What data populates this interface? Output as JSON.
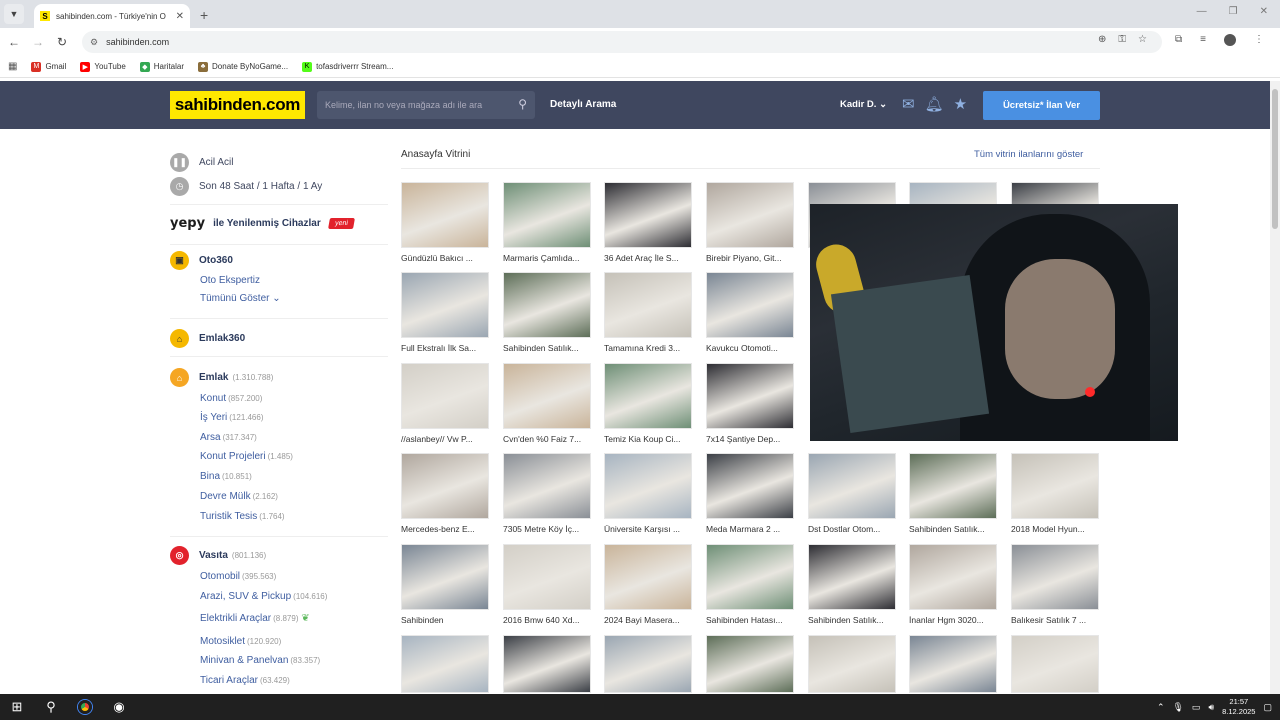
{
  "browser": {
    "tab_title": "sahibinden.com - Türkiye'nin O",
    "tab_favicon": "S",
    "url": "sahibinden.com",
    "bookmarks": [
      {
        "label": "Gmail",
        "icon": "gmail-icon",
        "color": "#d93025"
      },
      {
        "label": "YouTube",
        "icon": "youtube-icon",
        "color": "#ff0000"
      },
      {
        "label": "Haritalar",
        "icon": "maps-icon",
        "color": "#34a853"
      },
      {
        "label": "Donate ByNoGame...",
        "icon": "donate-icon",
        "color": "#8a6d3b"
      },
      {
        "label": "tofasdriverrr Stream...",
        "icon": "kick-icon",
        "color": "#53fc18"
      }
    ]
  },
  "header": {
    "logo": "sahibinden.com",
    "search_placeholder": "Kelime, ilan no veya mağaza adı ile ara",
    "detailed_search": "Detaylı Arama",
    "user": "Kadir D.",
    "post_button": "Ücretsiz* İlan Ver",
    "colors": {
      "bg": "#3f475f",
      "logo": "#ffe800",
      "button": "#4a90e2"
    }
  },
  "sidebar": {
    "acil": "Acil Acil",
    "son48": "Son 48 Saat / 1 Hafta / 1 Ay",
    "yepy": "yepy",
    "yepy_text": "ile Yenilenmiş Cihazlar",
    "yeni": "yeni",
    "oto360": "Oto360",
    "oto_ekspertiz": "Oto Ekspertiz",
    "tumunu": "Tümünü Göster",
    "emlak360": "Emlak360",
    "emlak": {
      "label": "Emlak",
      "count": "(1.310.788)"
    },
    "emlak_items": [
      {
        "label": "Konut",
        "count": "(857.200)"
      },
      {
        "label": "İş Yeri",
        "count": "(121.466)"
      },
      {
        "label": "Arsa",
        "count": "(317.347)"
      },
      {
        "label": "Konut Projeleri",
        "count": "(1.485)"
      },
      {
        "label": "Bina",
        "count": "(10.851)"
      },
      {
        "label": "Devre Mülk",
        "count": "(2.162)"
      },
      {
        "label": "Turistik Tesis",
        "count": "(1.764)"
      }
    ],
    "vasita": {
      "label": "Vasıta",
      "count": "(801.136)"
    },
    "vasita_items": [
      {
        "label": "Otomobil",
        "count": "(395.563)"
      },
      {
        "label": "Arazi, SUV & Pickup",
        "count": "(104.616)"
      },
      {
        "label": "Elektrikli Araçlar",
        "count": "(8.879)"
      },
      {
        "label": "Motosiklet",
        "count": "(120.920)"
      },
      {
        "label": "Minivan & Panelvan",
        "count": "(83.357)"
      },
      {
        "label": "Ticari Araçlar",
        "count": "(63.429)"
      }
    ]
  },
  "vitrin": {
    "title": "Anasayfa Vitrini",
    "show_all": "Tüm vitrin ilanlarını göster",
    "rows": [
      [
        "Gündüzlü Bakıcı ...",
        "Marmaris Çamlıda...",
        "36 Adet Araç İle S...",
        "Birebir Piyano, Git...",
        "",
        "",
        ""
      ],
      [
        "Full Ekstralı İlk Sa...",
        "Sahibinden Satılık...",
        "Tamamına Kredi 3...",
        "Kavukcu Otomoti...",
        "",
        "",
        ""
      ],
      [
        "//aslanbey// Vw P...",
        "Cvn'den %0 Faiz 7...",
        "Temiz Kia Koup Ci...",
        "7x14 Şantiye Dep...",
        "",
        "",
        ""
      ],
      [
        "Mercedes-benz E...",
        "7305 Metre Köy İç...",
        "Üniversite Karşısı ...",
        "Meda Marmara 2 ...",
        "Dst Dostlar Otom...",
        "Sahibinden Satılık...",
        "2018 Model Hyun..."
      ],
      [
        "Sahibinden",
        "2016 Bmw 640 Xd...",
        "2024 Bayi Masera...",
        "Sahibinden Hatası...",
        "Sahibinden Satılık...",
        "İnanlar Hgm 3020...",
        "Balıkesir Satılık 7 ..."
      ],
      [
        "",
        "",
        "",
        "",
        "",
        "",
        ""
      ]
    ]
  },
  "taskbar": {
    "time": "21:57",
    "date": "8.12.2025"
  }
}
